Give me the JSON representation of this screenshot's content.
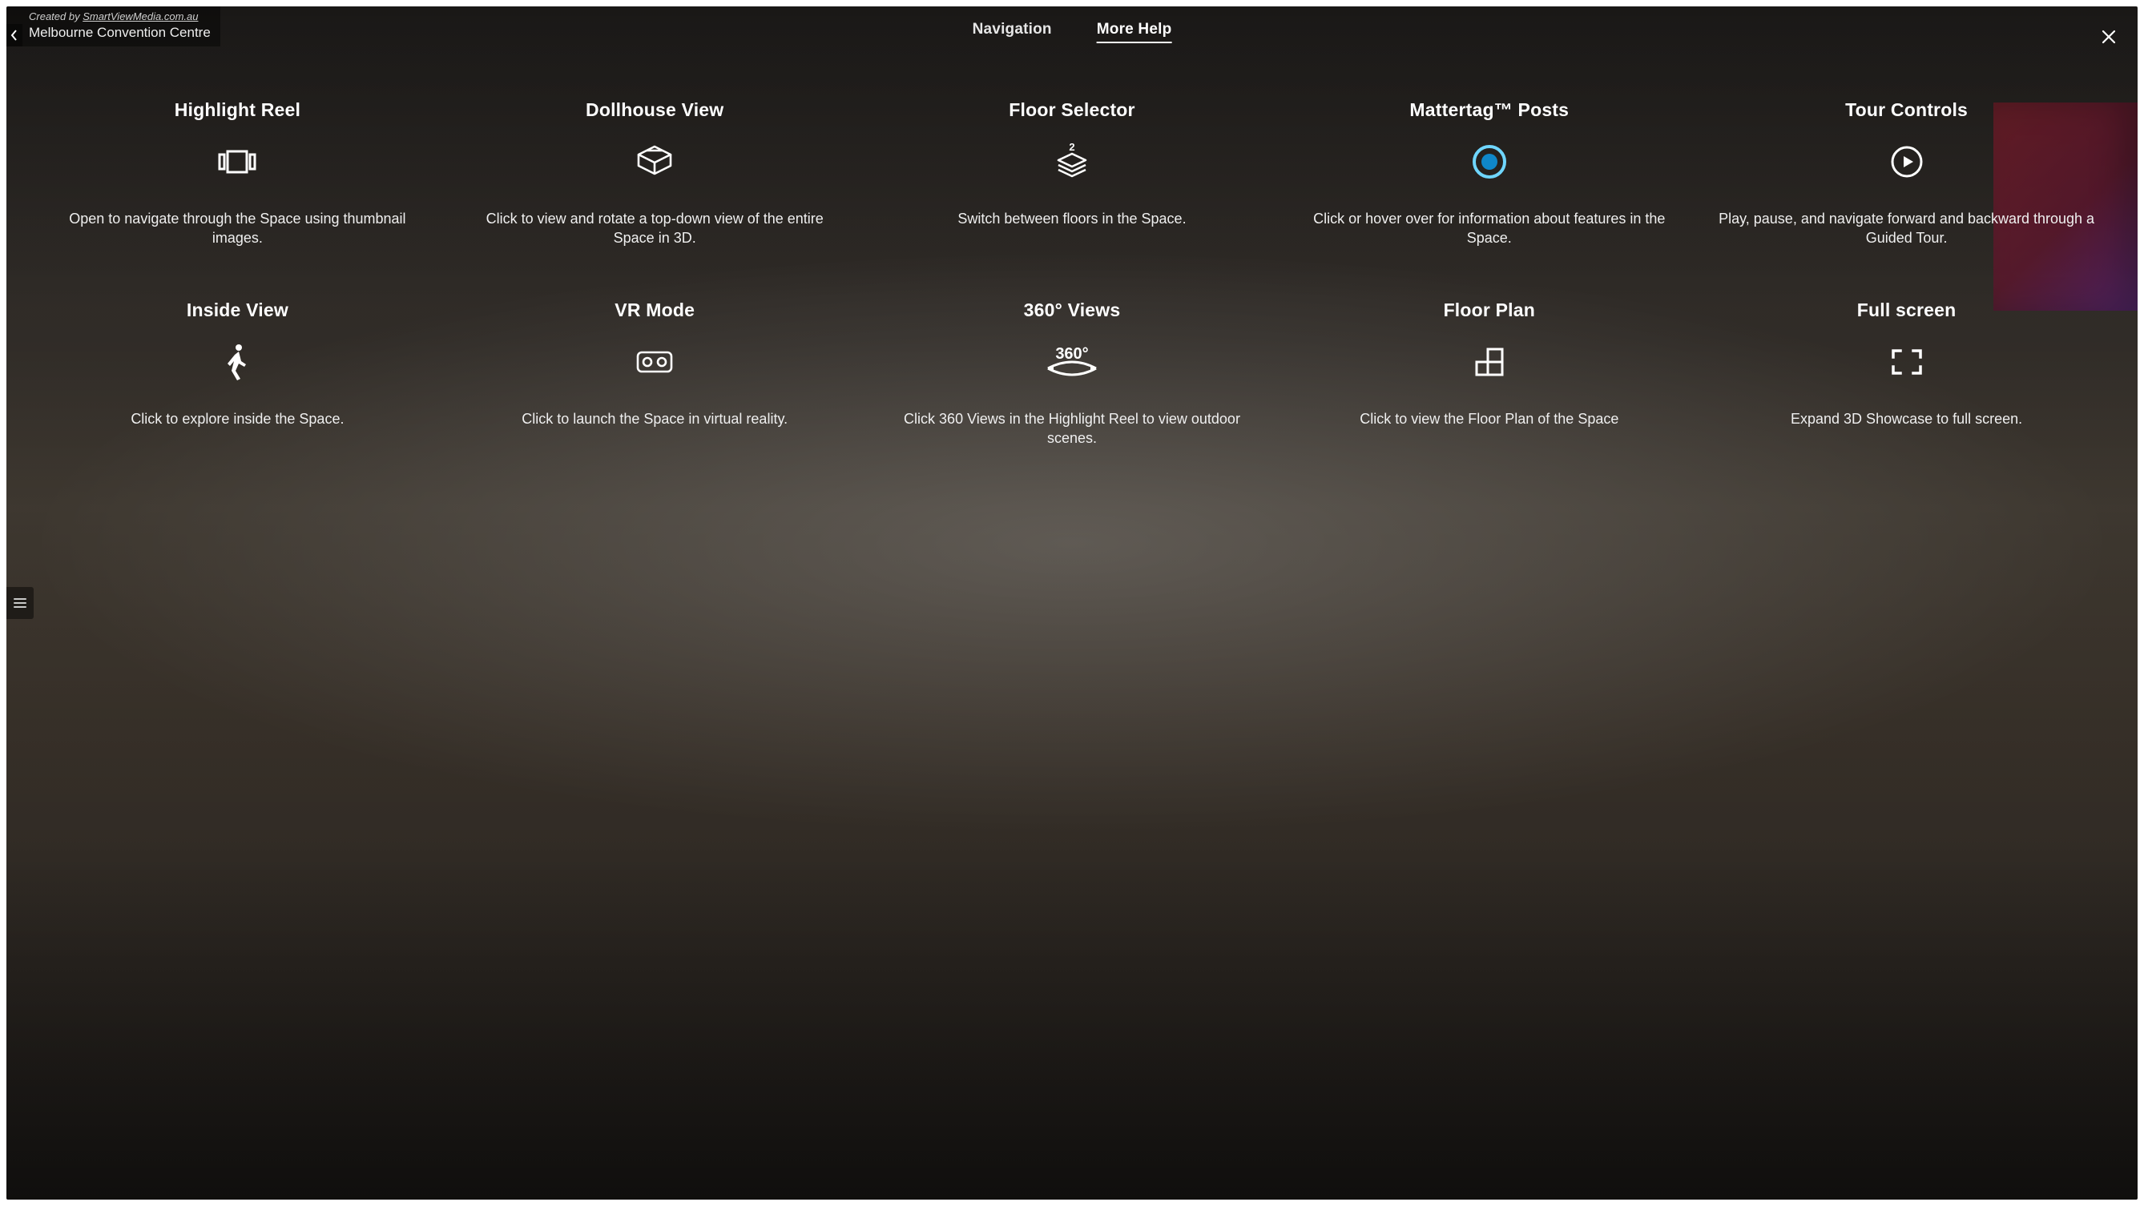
{
  "credit_prefix": "Created by ",
  "credit_link": "SmartViewMedia.com.au",
  "space_title": "Melbourne Convention Centre",
  "tabs": {
    "navigation": "Navigation",
    "more_help": "More Help"
  },
  "cards": [
    {
      "title": "Highlight Reel",
      "icon": "filmstrip-icon",
      "desc": "Open to navigate through the Space using thumbnail images."
    },
    {
      "title": "Dollhouse View",
      "icon": "dollhouse-icon",
      "desc": "Click to view and rotate a top-down view of the entire Space in 3D."
    },
    {
      "title": "Floor Selector",
      "icon": "floor-selector-icon",
      "desc": "Switch between floors in the Space."
    },
    {
      "title": "Mattertag™ Posts",
      "icon": "mattertag-icon",
      "desc": "Click or hover over for information about features in the Space."
    },
    {
      "title": "Tour Controls",
      "icon": "play-circle-icon",
      "desc": "Play, pause, and navigate forward and backward through a Guided Tour."
    },
    {
      "title": "Inside View",
      "icon": "walking-person-icon",
      "desc": "Click to explore inside the Space."
    },
    {
      "title": "VR Mode",
      "icon": "vr-headset-icon",
      "desc": "Click to launch the Space in virtual reality."
    },
    {
      "title": "360° Views",
      "icon": "three-sixty-icon",
      "desc": "Click 360 Views in the Highlight Reel to view outdoor scenes."
    },
    {
      "title": "Floor Plan",
      "icon": "floor-plan-icon",
      "desc": "Click to view the Floor Plan of the Space"
    },
    {
      "title": "Full screen",
      "icon": "fullscreen-icon",
      "desc": "Expand 3D Showcase to full screen."
    }
  ]
}
